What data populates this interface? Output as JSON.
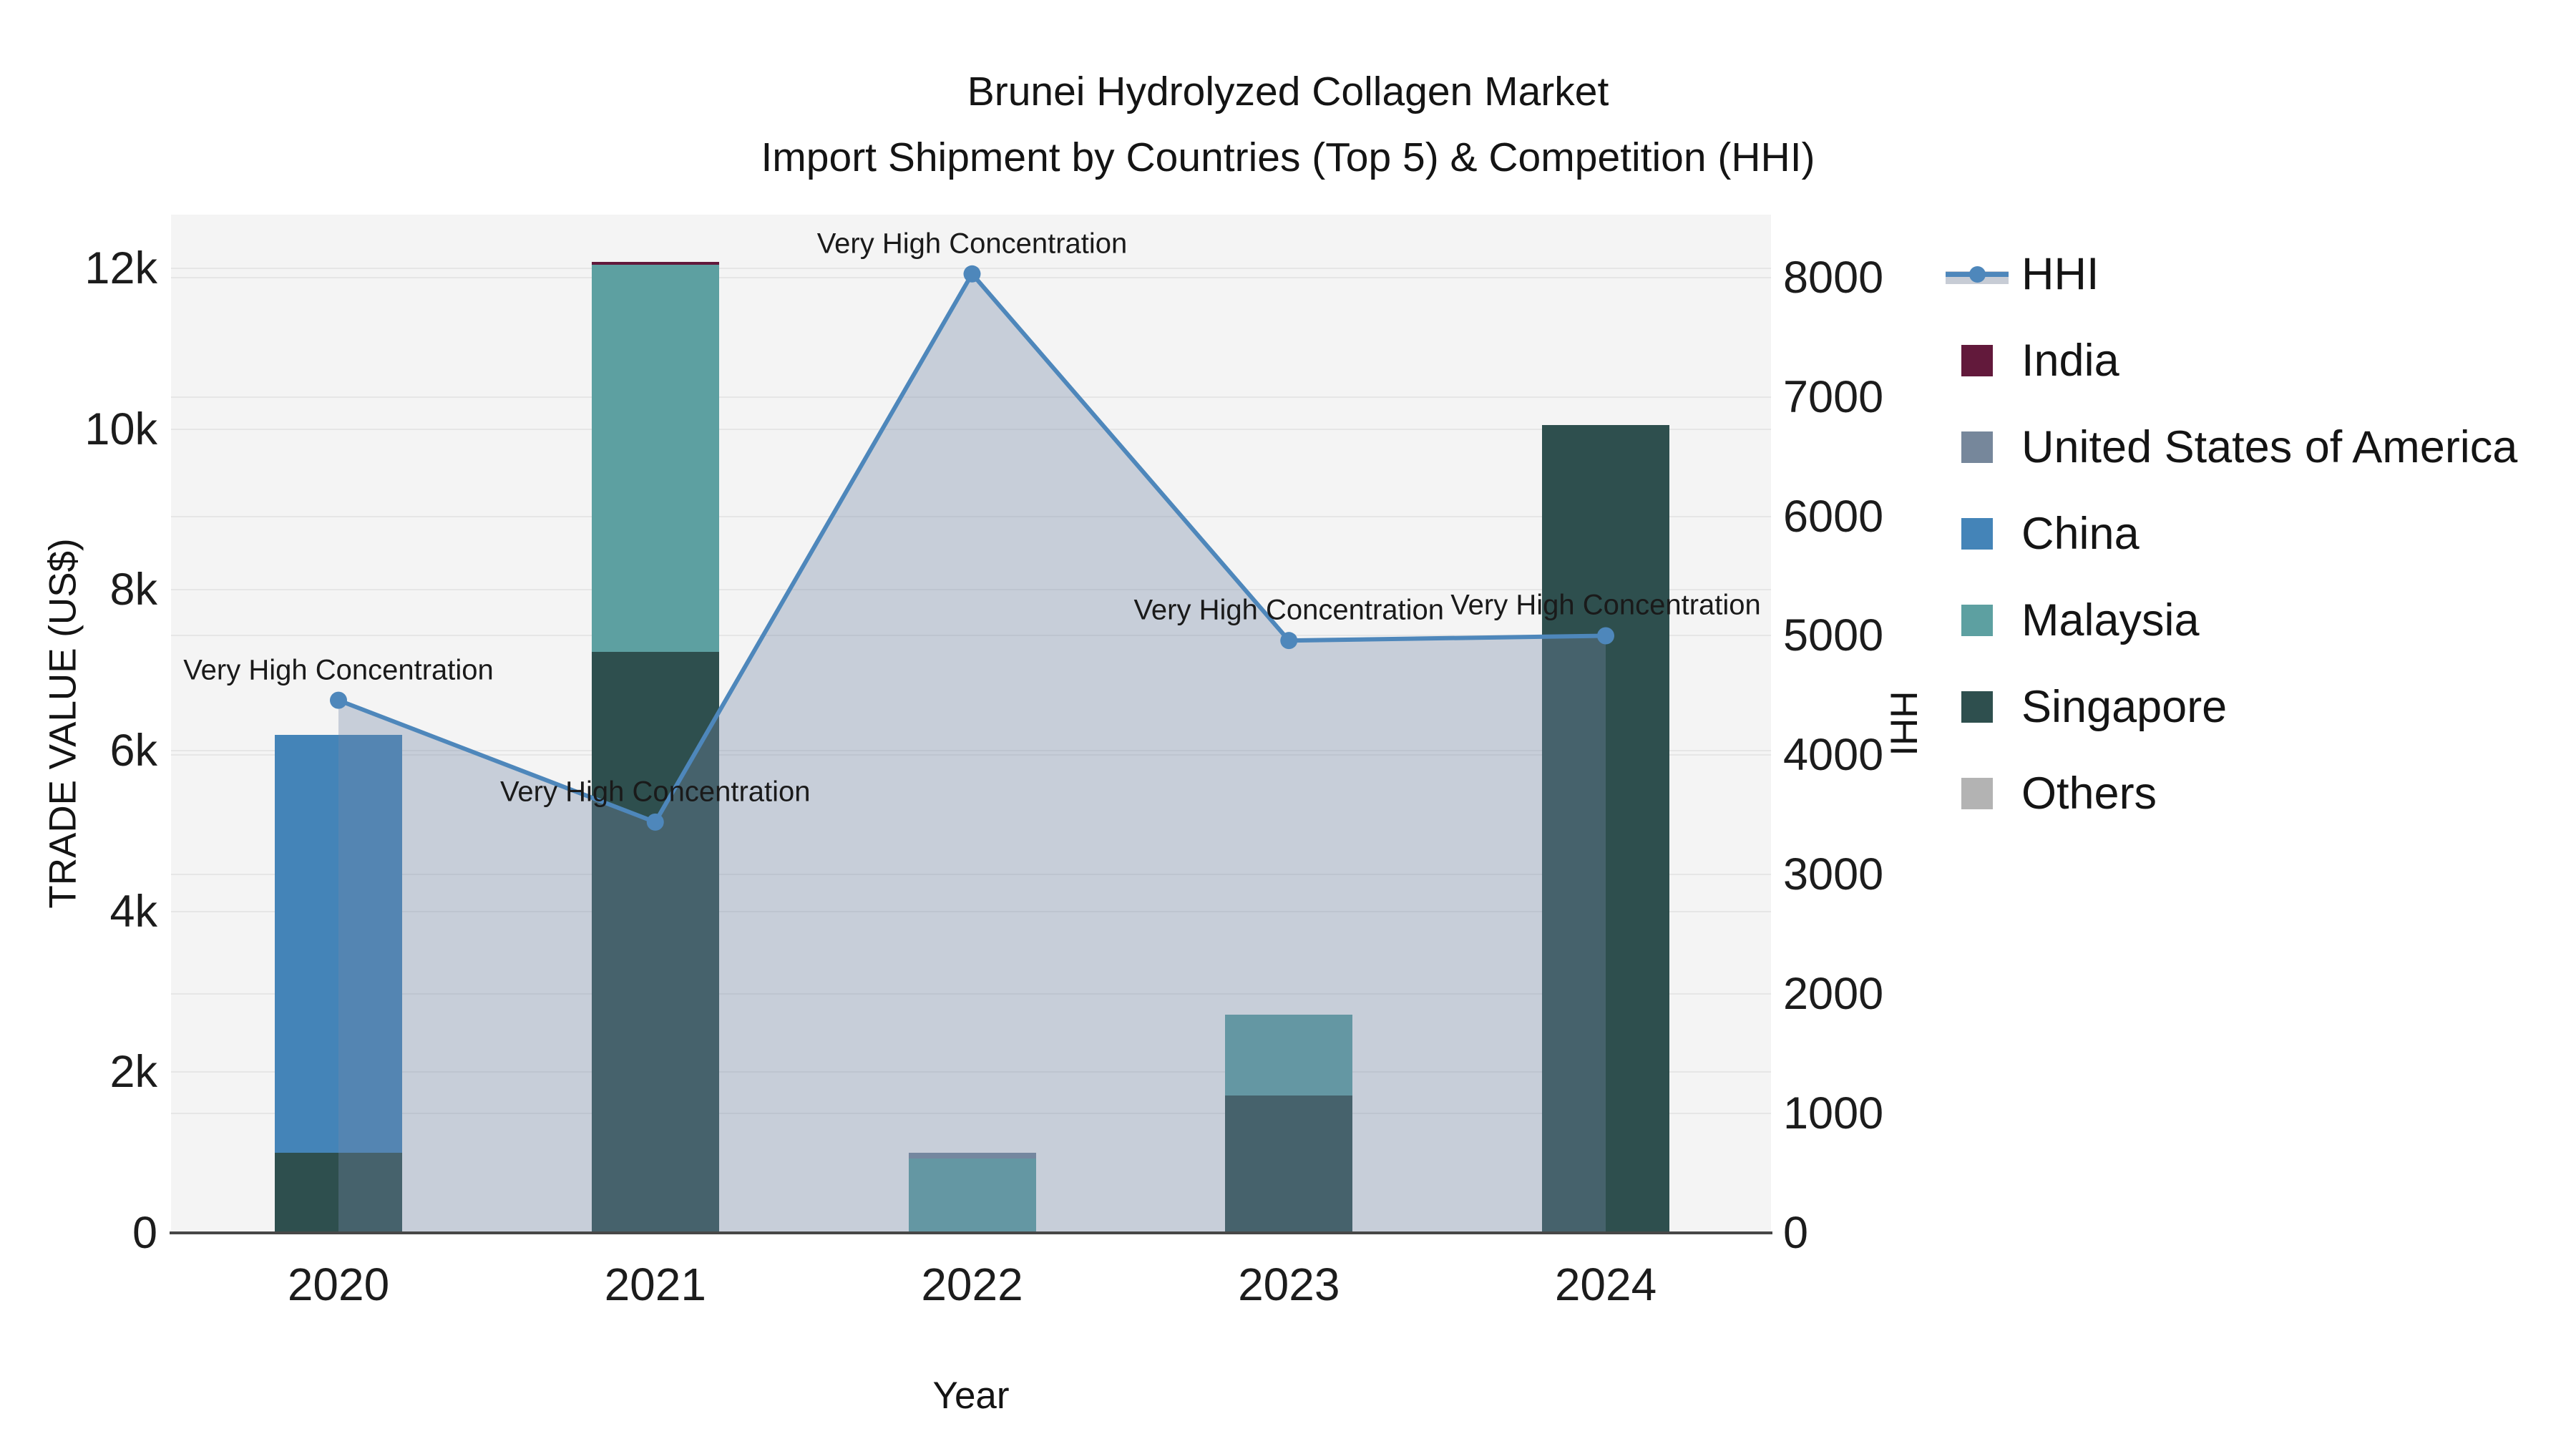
{
  "title": {
    "line1": "Brunei Hydrolyzed Collagen Market",
    "line2": "Import Shipment by Countries (Top 5) & Competition (HHI)"
  },
  "chart_data": {
    "type": "bar+line",
    "categories": [
      "2020",
      "2021",
      "2022",
      "2023",
      "2024"
    ],
    "bar_stack_order_note": "bottom to top",
    "series": [
      {
        "name": "Singapore",
        "type": "bar",
        "color": "#2e4f4e",
        "values": [
          1000,
          7230,
          0,
          1710,
          10050
        ]
      },
      {
        "name": "China",
        "type": "bar",
        "color": "#4484b8",
        "values": [
          5200,
          0,
          0,
          0,
          0
        ]
      },
      {
        "name": "Malaysia",
        "type": "bar",
        "color": "#5da0a1",
        "values": [
          0,
          4820,
          930,
          1010,
          0
        ]
      },
      {
        "name": "United States of America",
        "type": "bar",
        "color": "#76879b",
        "values": [
          0,
          0,
          70,
          0,
          0
        ]
      },
      {
        "name": "India",
        "type": "bar",
        "color": "#62193b",
        "values": [
          0,
          30,
          0,
          0,
          0
        ]
      },
      {
        "name": "Others",
        "type": "bar",
        "color": "#b3b3b3",
        "values": [
          0,
          0,
          0,
          0,
          0
        ]
      }
    ],
    "line_series": {
      "name": "HHI",
      "type": "line",
      "color": "#4e87bb",
      "fill_color": "rgba(115,135,165,0.35)",
      "values": [
        4460,
        3440,
        8030,
        4960,
        5000
      ]
    },
    "annotations": [
      {
        "x": "2020",
        "text": "Very High Concentration"
      },
      {
        "x": "2021",
        "text": "Very High Concentration"
      },
      {
        "x": "2022",
        "text": "Very High Concentration"
      },
      {
        "x": "2023",
        "text": "Very High Concentration"
      },
      {
        "x": "2024",
        "text": "Very High Concentration"
      }
    ],
    "left_axis": {
      "title": "TRADE VALUE (US$)",
      "tick_labels": [
        "0",
        "2k",
        "4k",
        "6k",
        "8k",
        "10k",
        "12k"
      ],
      "tick_values": [
        0,
        2000,
        4000,
        6000,
        8000,
        10000,
        12000
      ],
      "range": [
        0,
        12670
      ],
      "grid": true
    },
    "right_axis": {
      "title": "HHI",
      "tick_labels": [
        "0",
        "1000",
        "2000",
        "3000",
        "4000",
        "5000",
        "6000",
        "7000",
        "8000"
      ],
      "tick_values": [
        0,
        1000,
        2000,
        3000,
        4000,
        5000,
        6000,
        7000,
        8000
      ],
      "range": [
        0,
        8526
      ],
      "grid": true
    },
    "x_axis": {
      "title": "Year"
    },
    "legend": [
      {
        "label": "HHI",
        "color": "#4e87bb",
        "symbol": "line"
      },
      {
        "label": "India",
        "color": "#62193b",
        "symbol": "square"
      },
      {
        "label": "United States of America",
        "color": "#76879b",
        "symbol": "square"
      },
      {
        "label": "China",
        "color": "#4484b8",
        "symbol": "square"
      },
      {
        "label": "Malaysia",
        "color": "#5da0a1",
        "symbol": "square"
      },
      {
        "label": "Singapore",
        "color": "#2e4f4e",
        "symbol": "square"
      },
      {
        "label": "Others",
        "color": "#b3b3b3",
        "symbol": "square"
      }
    ],
    "background": {
      "plot": "#f4f4f4",
      "figure": "#ffffff",
      "gridline": "#e6e6e6"
    }
  }
}
